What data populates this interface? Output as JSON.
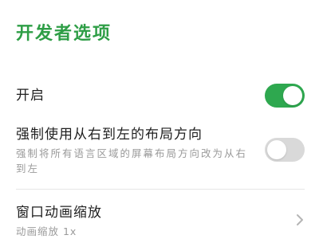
{
  "header": {
    "title": "开发者选项"
  },
  "settings": {
    "enable": {
      "label": "开启",
      "toggle_state": "on"
    },
    "rtl_layout": {
      "label": "强制使用从右到左的布局方向",
      "description": "强制将所有语言区域的屏幕布局方向改为从右到左",
      "toggle_state": "off"
    },
    "window_animation": {
      "label": "窗口动画缩放",
      "value": "动画缩放 1x"
    }
  },
  "colors": {
    "accent": "#2ea84f",
    "title": "#2e9e46",
    "toggle_off": "#d9d9d9"
  },
  "icons": {
    "chevron": "chevron-right-icon"
  }
}
